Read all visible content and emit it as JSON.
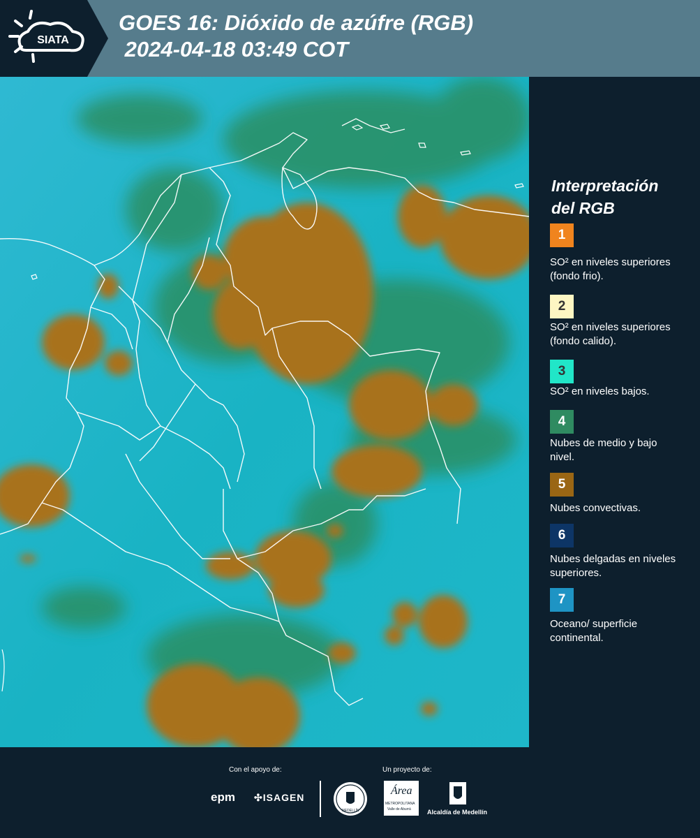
{
  "header": {
    "logo_text": "SIATA",
    "title_line1": "GOES 16: Dióxido de azúfre (RGB)",
    "title_line2": " 2024-04-18 03:49 COT"
  },
  "legend": {
    "title_line1": "Interpretación",
    "title_line2": "del RGB",
    "items": [
      {
        "number": "1",
        "color": "#f0841e",
        "text": "SO² en niveles superiores (fondo frio)."
      },
      {
        "number": "2",
        "color": "#fdf6c3",
        "text": "SO² en niveles superiores (fondo calido)."
      },
      {
        "number": "3",
        "color": "#21e6c8",
        "text": "SO² en niveles bajos."
      },
      {
        "number": "4",
        "color": "#2f8b61",
        "text": "Nubes de medio y bajo nivel."
      },
      {
        "number": "5",
        "color": "#9a6614",
        "text": "Nubes convectivas."
      },
      {
        "number": "6",
        "color": "#0d3566",
        "text": "Nubes delgadas en niveles superiores."
      },
      {
        "number": "7",
        "color": "#1e94c4",
        "text": "Oceano/ superficie continental."
      }
    ]
  },
  "footer": {
    "support_label": "Con el apoyo de:",
    "project_label": "Un proyecto de:",
    "logos": {
      "epm": "epm",
      "isagen": "ISAGEN",
      "area": "Área",
      "area_sub1": "METROPOLITANA",
      "area_sub2": "Valle de Aburrá",
      "alcaldia": "Alcaldía de Medellín",
      "seal_text": "MEDELLÍN"
    }
  },
  "colors": {
    "ocean_cyan": "#1bb2c7",
    "cloud_brown": "#a4701f",
    "cloud_green": "#2a8f5e",
    "border_white": "#ffffff",
    "header_bg": "#567c8c",
    "panel_bg": "#0d1f2d"
  }
}
